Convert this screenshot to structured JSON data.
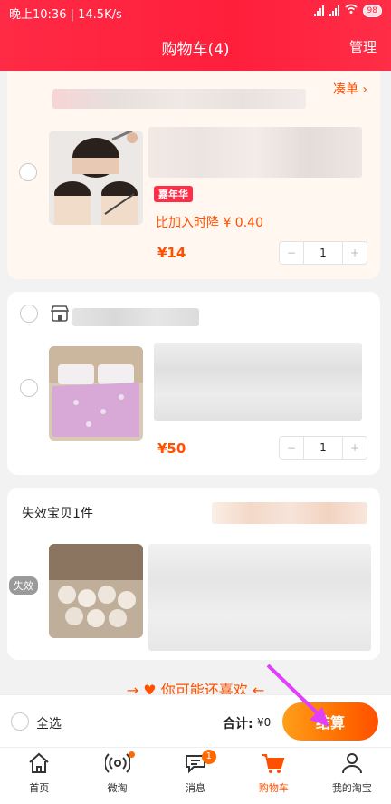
{
  "status": {
    "time": "晚上10:36",
    "speed": "14.5K/s",
    "battery": "98"
  },
  "header": {
    "title": "购物车(4)",
    "manage": "管理"
  },
  "shop1": {
    "pin_label": "凑单"
  },
  "item1": {
    "tag": "嘉年华",
    "price_drop": "比加入时降 ¥ 0.40",
    "price": "¥14",
    "qty": "1"
  },
  "item2": {
    "price": "¥50",
    "qty": "1"
  },
  "invalid": {
    "title": "失效宝贝1件",
    "badge": "失效"
  },
  "guess": {
    "label": "你可能还喜欢"
  },
  "checkout_bar": {
    "select_all": "全选",
    "total_label": "合计:",
    "total_value": "¥0",
    "checkout_label": "结算"
  },
  "tabs": [
    {
      "label": "首页",
      "icon": "home-icon"
    },
    {
      "label": "微淘",
      "icon": "broadcast-icon"
    },
    {
      "label": "消息",
      "icon": "message-icon",
      "badge": "1"
    },
    {
      "label": "购物车",
      "icon": "cart-icon"
    },
    {
      "label": "我的淘宝",
      "icon": "profile-icon"
    }
  ],
  "colors": {
    "brand_red": "#ff2a45",
    "accent_orange": "#ff5000"
  }
}
